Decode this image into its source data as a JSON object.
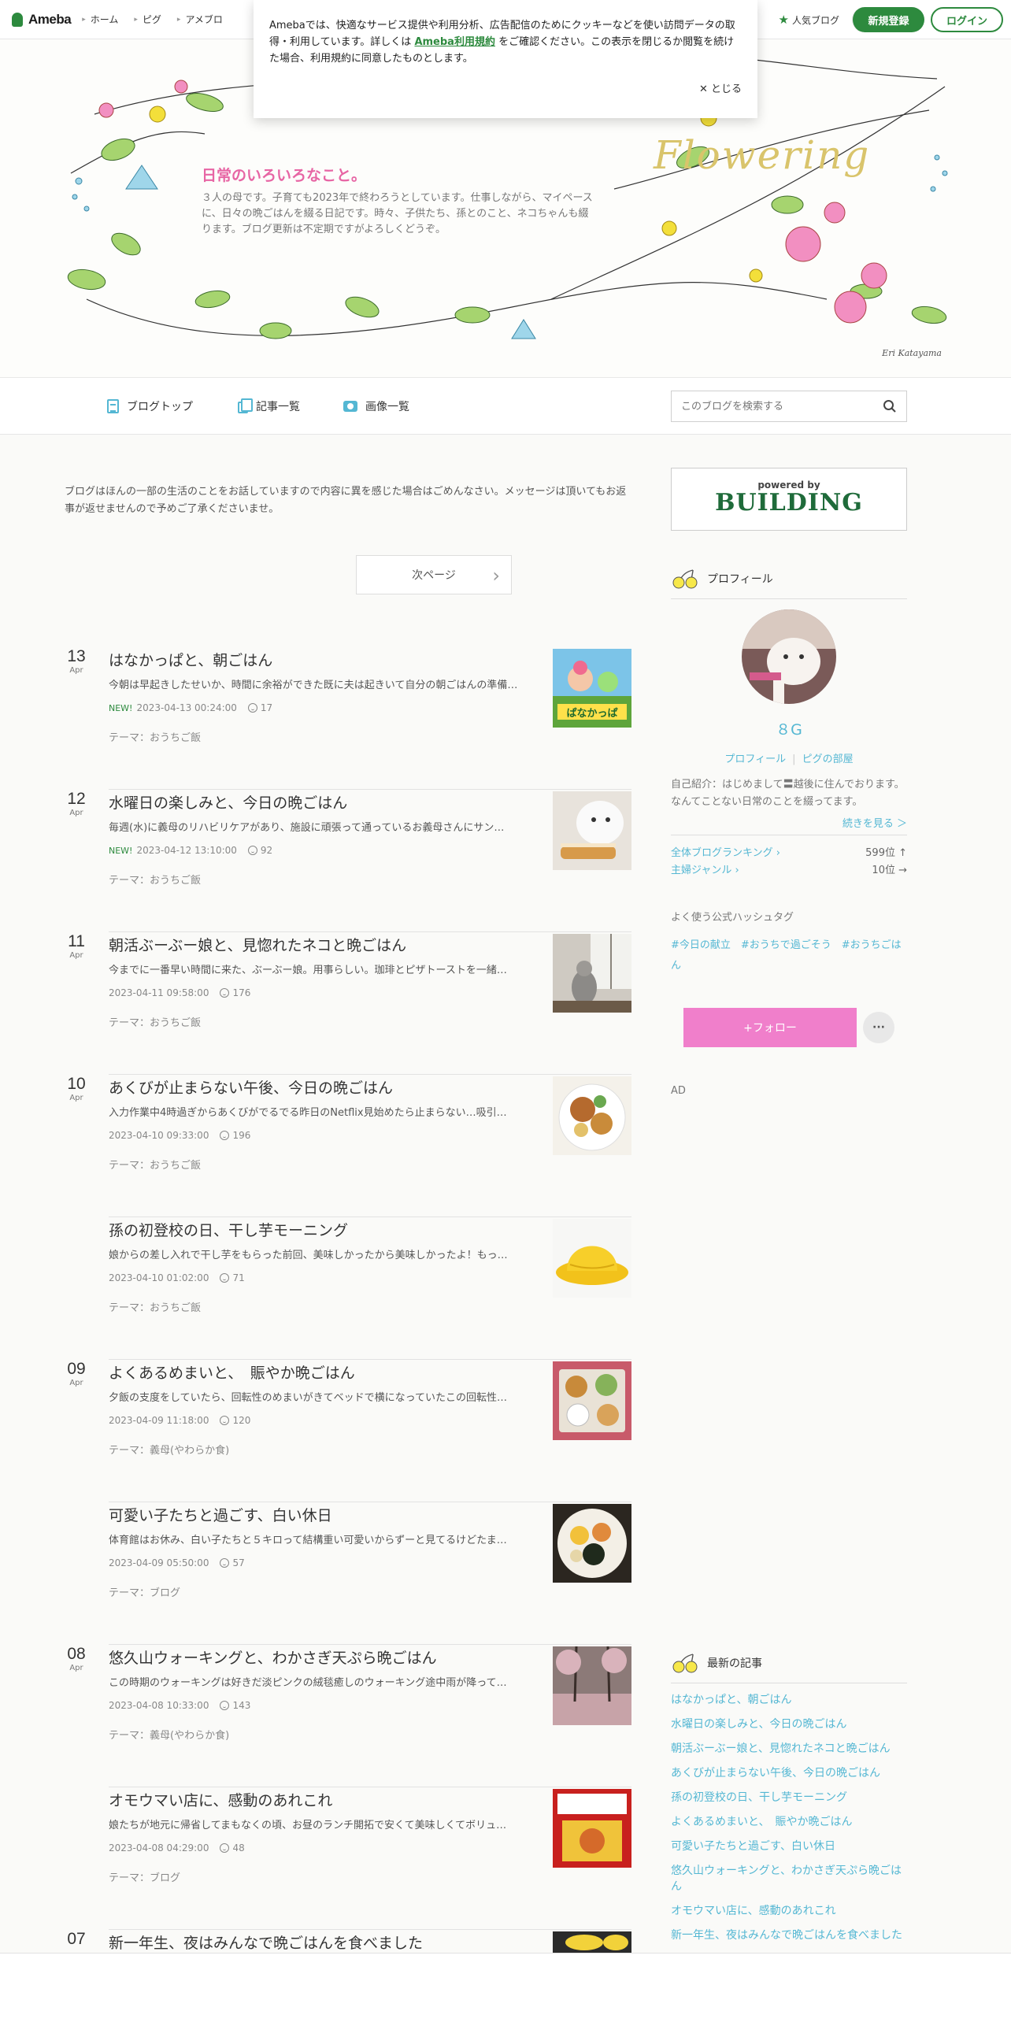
{
  "topbar": {
    "logo": "Ameba",
    "nav": [
      "ホーム",
      "ピグ",
      "アメブロ"
    ],
    "popular_label": "人気ブログ",
    "register_label": "新規登録",
    "login_label": "ログイン"
  },
  "cookie": {
    "text_before": "Amebaでは、快適なサービス提供や利用分析、広告配信のためにクッキーなどを使い訪問データの取得・利用しています。詳しくは",
    "link": "Ameba利用規約",
    "text_after": "をご確認ください。この表示を閉じるか閲覧を続けた場合、利用規約に同意したものとします。",
    "close_label": "✕ とじる"
  },
  "header": {
    "title": "日常のいろいろなこと。",
    "description": "３人の母です。子育ても2023年で終わろうとしています。仕事しながら、マイペースに、日々の晩ごはんを綴る日記です。時々、子供たち、孫とのこと、ネコちゃんも綴ります。ブログ更新は不定期ですがよろしくどうぞ。",
    "art_word": "Flowering",
    "author": "Eri Katayama"
  },
  "blognav": {
    "items": [
      "ブログトップ",
      "記事一覧",
      "画像一覧"
    ],
    "search_placeholder": "このブログを検索する"
  },
  "main": {
    "notice": "ブログはほんの一部の生活のことをお話していますので内容に異を感じた場合はごめんなさい。メッセージは頂いてもお返事が返せませんので予めご了承くださいませ。",
    "next_page": "次ページ",
    "entries": [
      {
        "day": "13",
        "month": "Apr",
        "title": "はなかっぱと、朝ごはん",
        "excerpt": "今朝は早起きしたせいか、時間に余裕ができた既に夫は起きいて自分の朝ごはんの準備…",
        "new": "NEW!",
        "datetime": "2023-04-13 00:24:00",
        "likes": "17",
        "theme": "テーマ：おうちご飯"
      },
      {
        "day": "12",
        "month": "Apr",
        "title": "水曜日の楽しみと、今日の晩ごはん",
        "excerpt": "毎週(水)に義母のリハビリケアがあり、施設に頑張って通っているお義母さんにサン…",
        "new": "NEW!",
        "datetime": "2023-04-12 13:10:00",
        "likes": "92",
        "theme": "テーマ：おうちご飯"
      },
      {
        "day": "11",
        "month": "Apr",
        "title": "朝活ぶーぶー娘と、見惚れたネコと晩ごはん",
        "excerpt": "今までに一番早い時間に来た、ぶーぶー娘。用事らしい。珈琲とピザトーストを一緒…",
        "new": "",
        "datetime": "2023-04-11 09:58:00",
        "likes": "176",
        "theme": "テーマ：おうちご飯"
      },
      {
        "day": "10",
        "month": "Apr",
        "title": "あくびが止まらない午後、今日の晩ごはん",
        "excerpt": "入力作業中4時過ぎからあくびがでるでる昨日のNetflix見始めたら止まらない…吸引…",
        "new": "",
        "datetime": "2023-04-10 09:33:00",
        "likes": "196",
        "theme": "テーマ：おうちご飯"
      },
      {
        "day": "",
        "month": "",
        "title": "孫の初登校の日、干し芋モーニング",
        "excerpt": "娘からの差し入れで干し芋をもらった前回、美味しかったから美味しかったよ！もっ…",
        "new": "",
        "datetime": "2023-04-10 01:02:00",
        "likes": "71",
        "theme": "テーマ：おうちご飯"
      },
      {
        "day": "09",
        "month": "Apr",
        "title": "よくあるめまいと、　賑やか晩ごはん",
        "excerpt": "夕飯の支度をしていたら、回転性のめまいがきてベッドで横になっていたこの回転性…",
        "new": "",
        "datetime": "2023-04-09 11:18:00",
        "likes": "120",
        "theme": "テーマ：義母(やわらか食)"
      },
      {
        "day": "",
        "month": "",
        "title": "可愛い子たちと過ごす、白い休日",
        "excerpt": "体育館はお休み、白い子たちと５キロって結構重い可愛いからずーと見てるけどたま…",
        "new": "",
        "datetime": "2023-04-09 05:50:00",
        "likes": "57",
        "theme": "テーマ：ブログ"
      },
      {
        "day": "08",
        "month": "Apr",
        "title": "悠久山ウォーキングと、わかさぎ天ぷら晩ごはん",
        "excerpt": "この時期のウォーキングは好きだ淡ピンクの絨毯癒しのウォーキング途中雨が降って…",
        "new": "",
        "datetime": "2023-04-08 10:33:00",
        "likes": "143",
        "theme": "テーマ：義母(やわらか食)"
      },
      {
        "day": "",
        "month": "",
        "title": "オモウマい店に、感動のあれこれ",
        "excerpt": "娘たちが地元に帰省してまもなくの頃、お昼のランチ開拓で安くて美味しくてボリュ…",
        "new": "",
        "datetime": "2023-04-08 04:29:00",
        "likes": "48",
        "theme": "テーマ：ブログ"
      },
      {
        "day": "07",
        "month": "",
        "title": "新一年生、夜はみんなで晩ごはんを食べました",
        "excerpt": "",
        "new": "",
        "datetime": "",
        "likes": "",
        "theme": ""
      }
    ]
  },
  "sidebar": {
    "building_small": "powered by",
    "building_big": "BUILDING",
    "profile_title": "プロフィール",
    "nickname": "８G",
    "profile_link": "プロフィール",
    "pig_link": "ピグの部屋",
    "intro": "自己紹介：はじめまして〓越後に住んでおります。 なんてことない日常のことを綴ってます。",
    "more": "続きを見る ＞",
    "ranking": [
      {
        "label": "全体ブログランキング ›",
        "value": "599位 ↑"
      },
      {
        "label": "主婦ジャンル ›",
        "value": "10位 →"
      }
    ],
    "hashtag_title": "よく使う公式ハッシュタグ",
    "hashtags": "#今日の献立　#おうちで過ごそう　#おうちごはん",
    "follow": "+フォロー",
    "more_menu": "···",
    "ad": "AD",
    "recent_title": "最新の記事",
    "recent": [
      "はなかっぱと、朝ごはん",
      "水曜日の楽しみと、今日の晩ごはん",
      "朝活ぶーぶー娘と、見惚れたネコと晩ごはん",
      "あくびが止まらない午後、今日の晩ごはん",
      "孫の初登校の日、干し芋モーニング",
      "よくあるめまいと、　賑やか晩ごはん",
      "可愛い子たちと過ごす、白い休日",
      "悠久山ウォーキングと、わかさぎ天ぷら晩ごはん",
      "オモウマい店に、感動のあれこれ",
      "新一年生、夜はみんなで晩ごはんを食べました"
    ]
  },
  "colors": {
    "accent": "#2d8a3e",
    "link": "#54b7d3",
    "title_pink": "#e765a4",
    "follow_pink": "#f07fcb"
  },
  "icons": [
    "star-icon",
    "doc-icon",
    "copy-icon",
    "camera-icon",
    "search-icon",
    "like-icon",
    "cherry-icon",
    "chevron-right-icon"
  ]
}
